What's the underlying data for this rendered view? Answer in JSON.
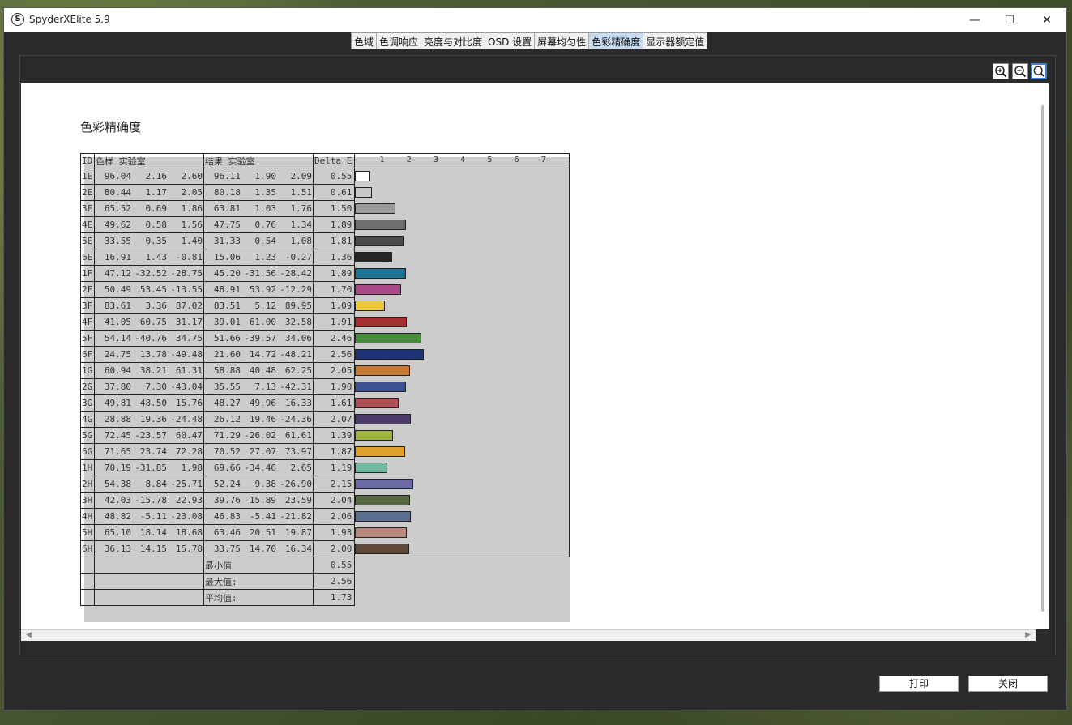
{
  "window": {
    "title": "SpyderXElite 5.9",
    "app_icon_glyph": "S",
    "minimize_glyph": "—",
    "maximize_glyph": "☐",
    "close_glyph": "✕"
  },
  "tabs": [
    {
      "label": "色域",
      "active": false
    },
    {
      "label": "色调响应",
      "active": false
    },
    {
      "label": "亮度与对比度",
      "active": false
    },
    {
      "label": "OSD 设置",
      "active": false
    },
    {
      "label": "屏幕均匀性",
      "active": false
    },
    {
      "label": "色彩精确度",
      "active": true
    },
    {
      "label": "显示器额定值",
      "active": false
    }
  ],
  "zoom_icons": [
    "zoom-in-icon",
    "zoom-out-icon",
    "zoom-fit-icon"
  ],
  "report": {
    "heading": "色彩精确度",
    "headers": {
      "id": "ID",
      "sample": "色样 实验室",
      "result": "结果 实验室",
      "delta": "Delta E"
    },
    "scale_ticks": [
      "1",
      "2",
      "3",
      "4",
      "5",
      "6",
      "7"
    ],
    "rows": [
      {
        "id": "1E",
        "s": [
          "96.04",
          "2.16",
          "2.60"
        ],
        "r": [
          "96.11",
          "1.90",
          "2.09"
        ],
        "d": "0.55",
        "color": "#ffffff"
      },
      {
        "id": "2E",
        "s": [
          "80.44",
          "1.17",
          "2.05"
        ],
        "r": [
          "80.18",
          "1.35",
          "1.51"
        ],
        "d": "0.61",
        "color": "#c8c8c8"
      },
      {
        "id": "3E",
        "s": [
          "65.52",
          "0.69",
          "1.86"
        ],
        "r": [
          "63.81",
          "1.03",
          "1.76"
        ],
        "d": "1.50",
        "color": "#9a9a9a"
      },
      {
        "id": "4E",
        "s": [
          "49.62",
          "0.58",
          "1.56"
        ],
        "r": [
          "47.75",
          "0.76",
          "1.34"
        ],
        "d": "1.89",
        "color": "#6f6f6f"
      },
      {
        "id": "5E",
        "s": [
          "33.55",
          "0.35",
          "1.40"
        ],
        "r": [
          "31.33",
          "0.54",
          "1.08"
        ],
        "d": "1.81",
        "color": "#4a4a4a"
      },
      {
        "id": "6E",
        "s": [
          "16.91",
          "1.43",
          "-0.81"
        ],
        "r": [
          "15.06",
          "1.23",
          "-0.27"
        ],
        "d": "1.36",
        "color": "#262626"
      },
      {
        "id": "1F",
        "s": [
          "47.12",
          "-32.52",
          "-28.75"
        ],
        "r": [
          "45.20",
          "-31.56",
          "-28.42"
        ],
        "d": "1.89",
        "color": "#1d7696"
      },
      {
        "id": "2F",
        "s": [
          "50.49",
          "53.45",
          "-13.55"
        ],
        "r": [
          "48.91",
          "53.92",
          "-12.29"
        ],
        "d": "1.70",
        "color": "#a94a86"
      },
      {
        "id": "3F",
        "s": [
          "83.61",
          "3.36",
          "87.02"
        ],
        "r": [
          "83.51",
          "5.12",
          "89.95"
        ],
        "d": "1.09",
        "color": "#eec63a"
      },
      {
        "id": "4F",
        "s": [
          "41.05",
          "60.75",
          "31.17"
        ],
        "r": [
          "39.01",
          "61.00",
          "32.58"
        ],
        "d": "1.91",
        "color": "#a32f2f"
      },
      {
        "id": "5F",
        "s": [
          "54.14",
          "-40.76",
          "34.75"
        ],
        "r": [
          "51.66",
          "-39.57",
          "34.06"
        ],
        "d": "2.46",
        "color": "#4a8a3e"
      },
      {
        "id": "6F",
        "s": [
          "24.75",
          "13.78",
          "-49.48"
        ],
        "r": [
          "21.60",
          "14.72",
          "-48.21"
        ],
        "d": "2.56",
        "color": "#1e3477"
      },
      {
        "id": "1G",
        "s": [
          "60.94",
          "38.21",
          "61.31"
        ],
        "r": [
          "58.88",
          "40.48",
          "62.25"
        ],
        "d": "2.05",
        "color": "#c77a33"
      },
      {
        "id": "2G",
        "s": [
          "37.80",
          "7.30",
          "-43.04"
        ],
        "r": [
          "35.55",
          "7.13",
          "-42.31"
        ],
        "d": "1.90",
        "color": "#3e5394"
      },
      {
        "id": "3G",
        "s": [
          "49.81",
          "48.50",
          "15.76"
        ],
        "r": [
          "48.27",
          "49.96",
          "16.33"
        ],
        "d": "1.61",
        "color": "#ad5157"
      },
      {
        "id": "4G",
        "s": [
          "28.88",
          "19.36",
          "-24.48"
        ],
        "r": [
          "26.12",
          "19.46",
          "-24.36"
        ],
        "d": "2.07",
        "color": "#4b3a6a"
      },
      {
        "id": "5G",
        "s": [
          "72.45",
          "-23.57",
          "60.47"
        ],
        "r": [
          "71.29",
          "-26.02",
          "61.61"
        ],
        "d": "1.39",
        "color": "#9db540"
      },
      {
        "id": "6G",
        "s": [
          "71.65",
          "23.74",
          "72.28"
        ],
        "r": [
          "70.52",
          "27.07",
          "73.97"
        ],
        "d": "1.87",
        "color": "#e0a02c"
      },
      {
        "id": "1H",
        "s": [
          "70.19",
          "-31.85",
          "1.98"
        ],
        "r": [
          "69.66",
          "-34.46",
          "2.65"
        ],
        "d": "1.19",
        "color": "#6fbba2"
      },
      {
        "id": "2H",
        "s": [
          "54.38",
          "8.84",
          "-25.71"
        ],
        "r": [
          "52.24",
          "9.38",
          "-26.90"
        ],
        "d": "2.15",
        "color": "#6c6aa2"
      },
      {
        "id": "3H",
        "s": [
          "42.03",
          "-15.78",
          "22.93"
        ],
        "r": [
          "39.76",
          "-15.89",
          "23.59"
        ],
        "d": "2.04",
        "color": "#56683f"
      },
      {
        "id": "4H",
        "s": [
          "48.82",
          "-5.11",
          "-23.08"
        ],
        "r": [
          "46.83",
          "-5.41",
          "-21.82"
        ],
        "d": "2.06",
        "color": "#5a6f90"
      },
      {
        "id": "5H",
        "s": [
          "65.10",
          "18.14",
          "18.68"
        ],
        "r": [
          "63.46",
          "20.51",
          "19.87"
        ],
        "d": "1.93",
        "color": "#b6897a"
      },
      {
        "id": "6H",
        "s": [
          "36.13",
          "14.15",
          "15.78"
        ],
        "r": [
          "33.75",
          "14.70",
          "16.34"
        ],
        "d": "2.00",
        "color": "#5f4a3a"
      }
    ],
    "stats": [
      {
        "label": "最小值",
        "value": "0.55"
      },
      {
        "label": "最大值:",
        "value": "2.56"
      },
      {
        "label": "平均值:",
        "value": "1.73"
      }
    ]
  },
  "buttons": {
    "print": "打印",
    "close": "关闭"
  }
}
